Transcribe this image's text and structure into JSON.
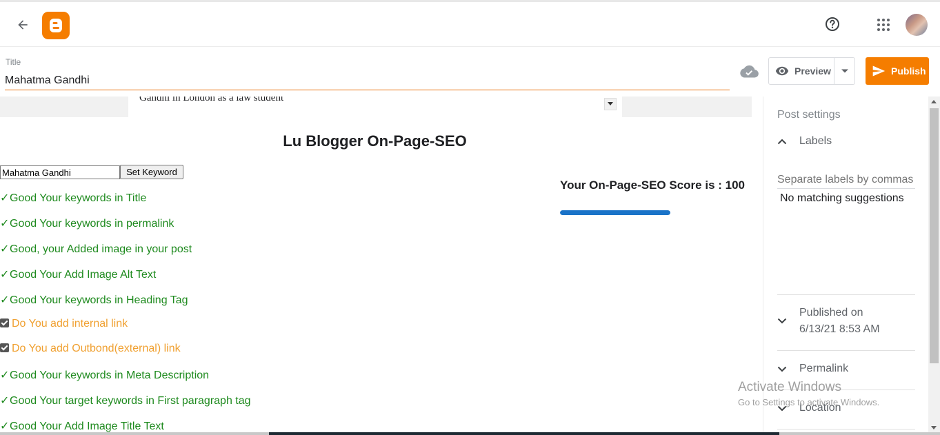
{
  "header": {
    "back_icon": "arrow-left-icon",
    "logo_icon": "blogger-logo",
    "help_icon": "help-circle-icon",
    "apps_icon": "apps-grid-icon",
    "avatar_icon": "user-avatar"
  },
  "title": {
    "label": "Title",
    "value": "Mahatma Gandhi",
    "cloud_icon": "cloud-saved-icon"
  },
  "actions": {
    "preview_label": "Preview",
    "preview_icon": "eye-icon",
    "publish_label": "Publish",
    "publish_icon": "send-icon",
    "publish_color": "#f57d00"
  },
  "editor": {
    "visible_text": "Gandhi in London as a law student"
  },
  "seo": {
    "title": "Lu Blogger On-Page-SEO",
    "keyword_value": "Mahatma Gandhi",
    "set_keyword_label": "Set Keyword",
    "score_text": "Your On-Page-SEO Score is : 100",
    "score_fraction": 1.0,
    "good_color": "#1e8a1e",
    "warn_color": "#f0a030",
    "bar_color": "#1a73c8",
    "checks": [
      {
        "mark": "✓",
        "text": "Good Your keywords in Title",
        "status": "good"
      },
      {
        "mark": "✓",
        "text": "Good Your keywords in permalink",
        "status": "good"
      },
      {
        "mark": "✓",
        "text": "Good, your Added image in your post",
        "status": "good"
      },
      {
        "mark": "✓",
        "text": "Good Your Add Image Alt Text",
        "status": "good"
      },
      {
        "mark": "✓",
        "text": "Good Your keywords in Heading Tag",
        "status": "good"
      },
      {
        "mark": "",
        "text": "Do You add internal link",
        "status": "warn"
      },
      {
        "mark": "",
        "text": "Do You add Outbond(external) link",
        "status": "warn"
      },
      {
        "mark": "✓",
        "text": "Good Your keywords in Meta Description",
        "status": "good"
      },
      {
        "mark": "✓",
        "text": "Good Your target keywords in First paragraph tag",
        "status": "good"
      },
      {
        "mark": "✓",
        "text": "Good Your Add Image Title Text",
        "status": "good"
      }
    ]
  },
  "sidebar": {
    "heading": "Post settings",
    "labels_title": "Labels",
    "labels_placeholder": "Separate labels by commas",
    "no_match": "No matching suggestions",
    "published_title": "Published on",
    "published_value": "6/13/21 8:53 AM",
    "permalink_title": "Permalink",
    "location_title": "Location"
  },
  "watermark": {
    "title": "Activate Windows",
    "subtitle": "Go to Settings to activate Windows."
  }
}
